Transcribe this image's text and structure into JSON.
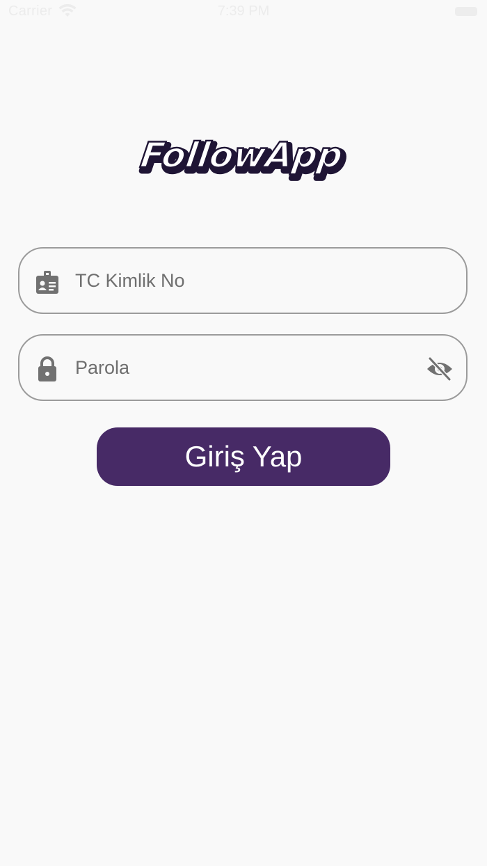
{
  "status_bar": {
    "carrier": "Carrier",
    "time": "7:39 PM"
  },
  "logo": {
    "text": "FollowApp",
    "fill_color": "#ffffff",
    "shadow_color": "#1f1535"
  },
  "form": {
    "id_field": {
      "placeholder": "TC Kimlik No",
      "value": "",
      "icon": "id-badge-icon"
    },
    "password_field": {
      "placeholder": "Parola",
      "value": "",
      "icon": "lock-icon",
      "toggle_icon": "eye-off-icon"
    },
    "submit_label": "Giriş Yap"
  },
  "colors": {
    "background": "#f9f9f9",
    "primary": "#472a66",
    "field_border": "#9b9b9b",
    "icon": "#717171"
  }
}
